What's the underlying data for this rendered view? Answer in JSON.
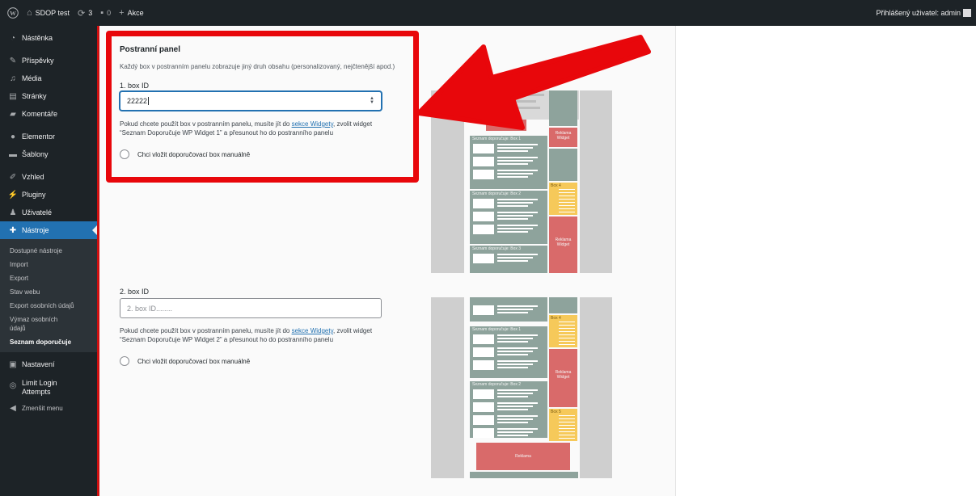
{
  "adminbar": {
    "site_name": "SDOP test",
    "updates_count": "3",
    "comments_count": "0",
    "new_label": "Akce",
    "account": "Přihlášený uživatel: admin"
  },
  "sidebar": {
    "items": [
      {
        "label": "Nástěnka",
        "icon": "dashboard-icon"
      },
      {
        "label": "Příspěvky",
        "icon": "pin-icon"
      },
      {
        "label": "Média",
        "icon": "media-icon"
      },
      {
        "label": "Stránky",
        "icon": "page-icon"
      },
      {
        "label": "Komentáře",
        "icon": "comment-icon"
      },
      {
        "label": "Elementor",
        "icon": "elementor-icon"
      },
      {
        "label": "Šablony",
        "icon": "folder-icon"
      },
      {
        "label": "Vzhled",
        "icon": "brush-icon"
      },
      {
        "label": "Pluginy",
        "icon": "plugin-icon"
      },
      {
        "label": "Uživatelé",
        "icon": "user-icon"
      },
      {
        "label": "Nástroje",
        "icon": "wrench-icon"
      },
      {
        "label": "Nastavení",
        "icon": "settings-icon"
      },
      {
        "label": "Limit Login Attempts",
        "icon": "fingerprint-icon"
      },
      {
        "label": "Zmenšit menu",
        "icon": "collapse-icon"
      }
    ],
    "submenu": [
      "Dostupné nástroje",
      "Import",
      "Export",
      "Stav webu",
      "Export osobních údajů",
      "Výmaz osobních údajů",
      "Seznam doporučuje"
    ]
  },
  "section": {
    "title": "Postranní panel",
    "description": "Každý box v postranním panelu zobrazuje jiný druh obsahu (personalizovaný, nejčtenější apod.)"
  },
  "box1": {
    "label": "1. box ID",
    "value": "22222",
    "help_before": "Pokud chcete použít box v postranním panelu, musíte jít do ",
    "help_link": "sekce Widgety",
    "help_after": ", zvolit widget",
    "help_line2": "“Seznam Doporučuje WP Widget 1” a přesunout ho do postranního panelu",
    "checkbox_label": "Chci vložit doporučovací box manuálně"
  },
  "box2": {
    "label": "2. box ID",
    "placeholder": "2. box ID........",
    "help_before": "Pokud chcete použít box v postranním panelu, musíte jít do ",
    "help_link": "sekce Widgety",
    "help_after": ", zvolit widget",
    "help_line2": "“Seznam Doporučuje WP Widget 2” a přesunout ho do postranního panelu",
    "checkbox_label": "Chci vložit doporučovací box manuálně"
  },
  "preview1": {
    "ad_small": "Reklama",
    "widget_label_top": "Reklama\nWidget",
    "widget_label_bottom": "Reklama\nWidget",
    "box_titles": [
      "Seznam doporučuje: Box 1",
      "Seznam doporučuje: Box 2",
      "Seznam doporučuje: Box 3"
    ],
    "yellow_label": "Box 4"
  },
  "preview2": {
    "widget_label": "Reklama\nWidget",
    "box_titles": [
      "Seznam doporučuje: Box 1",
      "Seznam doporučuje: Box 2"
    ],
    "yellow_label_1": "Box 4",
    "yellow_label_2": "Box 5",
    "ad_bottom": "Reklama"
  },
  "colors": {
    "admin_dark": "#1d2327",
    "active_blue": "#2271b1",
    "highlight_red": "#e8070b",
    "preview_green": "#8ea39c",
    "preview_red": "#d96a6a",
    "preview_yellow": "#f6c95a"
  }
}
